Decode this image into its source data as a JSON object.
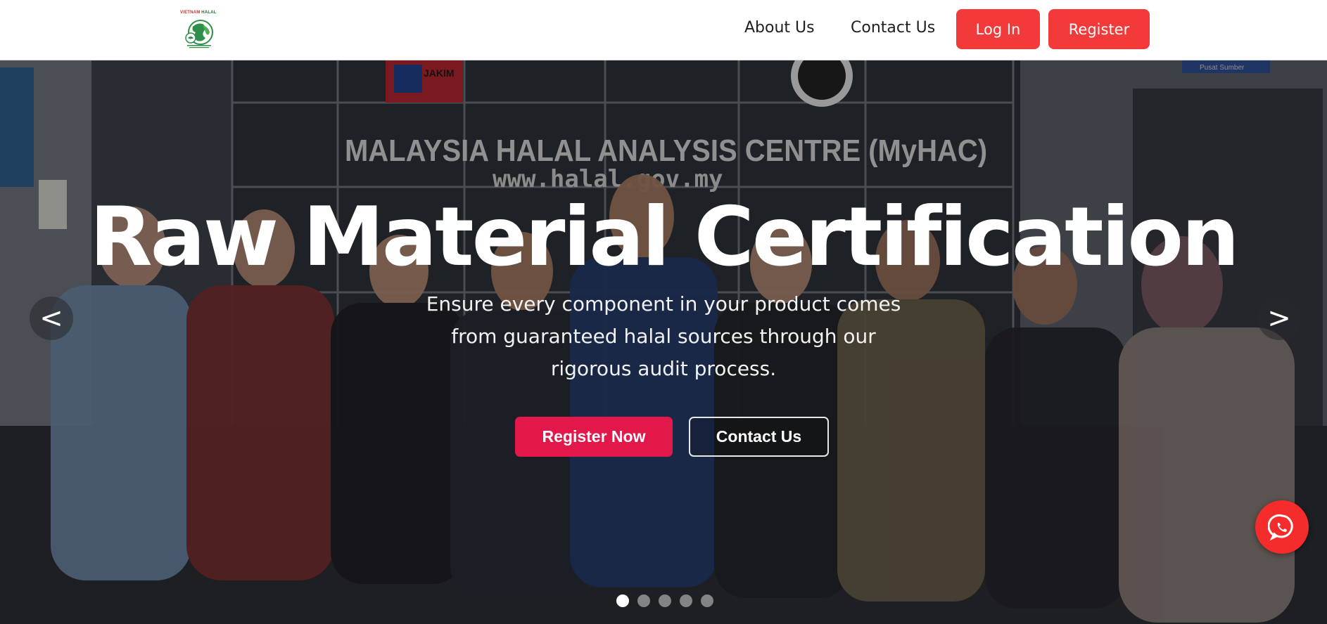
{
  "header": {
    "logo": {
      "brand_prefix": "VIETNAM",
      "brand_suffix": "HALAL",
      "icon": "globe-halal-logo-icon"
    },
    "nav": {
      "about_label": "About Us",
      "contact_label": "Contact Us",
      "login_label": "Log In",
      "register_label": "Register"
    }
  },
  "hero": {
    "title": "Raw Material Certification",
    "subtitle": "Ensure every component in your product comes from guaranteed halal sources through our rigorous audit process.",
    "primary_cta": "Register Now",
    "secondary_cta": "Contact Us",
    "prev_label": "<",
    "next_label": ">",
    "slides_total": 5,
    "active_slide": 1,
    "background_sign": {
      "line1": "MALAYSIA HALAL ANALYSIS CENTRE (MyHAC)",
      "line2": "www.halal.gov.my",
      "badge": "JAKIM",
      "door_sign": "Pusat Sumber"
    }
  },
  "floating": {
    "whatsapp_icon": "whatsapp-icon"
  },
  "colors": {
    "brand_red": "#f23a3a",
    "cta_red": "#e3184a",
    "whatsapp_bg": "#f42c2c",
    "header_bg": "#ffffff"
  }
}
